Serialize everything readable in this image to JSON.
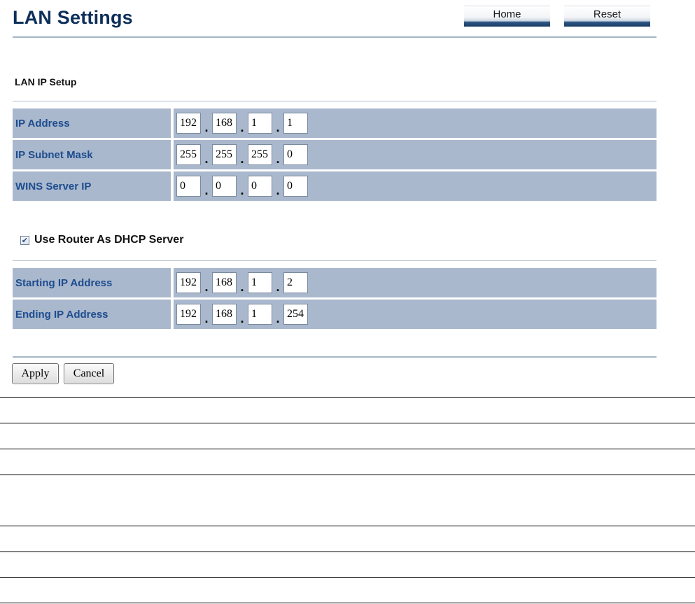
{
  "header": {
    "title": "LAN Settings",
    "home_label": "Home",
    "reset_label": "Reset"
  },
  "lan_ip_setup": {
    "section_title": "LAN IP Setup",
    "rows": [
      {
        "label": "IP Address",
        "octets": [
          "192",
          "168",
          "1",
          "1"
        ]
      },
      {
        "label": "IP Subnet Mask",
        "octets": [
          "255",
          "255",
          "255",
          "0"
        ]
      },
      {
        "label": "WINS Server IP",
        "octets": [
          "0",
          "0",
          "0",
          "0"
        ]
      }
    ]
  },
  "dhcp": {
    "checkbox_label": "Use Router As DHCP Server",
    "checked": true,
    "rows": [
      {
        "label": "Starting IP Address",
        "octets": [
          "192",
          "168",
          "1",
          "2"
        ]
      },
      {
        "label": "Ending IP Address",
        "octets": [
          "192",
          "168",
          "1",
          "254"
        ]
      }
    ]
  },
  "actions": {
    "apply_label": "Apply",
    "cancel_label": "Cancel"
  },
  "colors": {
    "title": "#0d2f5a",
    "row_background": "#a9b8cc",
    "row_label": "#1d4c8f",
    "rule": "#a5b5c8"
  }
}
